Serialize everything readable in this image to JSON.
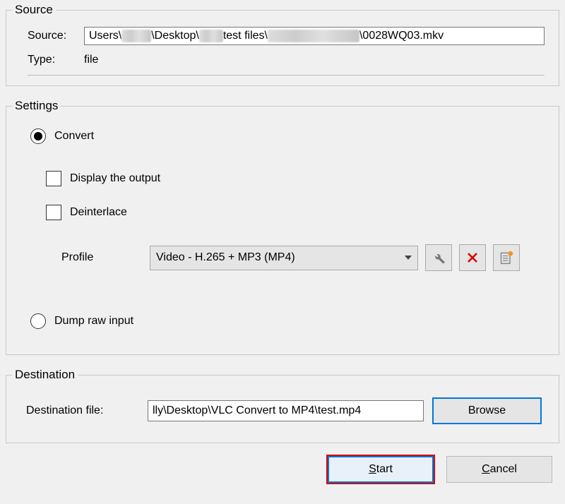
{
  "source": {
    "legend": "Source",
    "path_label": "Source:",
    "path_prefix": "Users\\",
    "path_middle1": "\\Desktop\\",
    "path_middle2": "test files\\",
    "path_filename": "\\0028WQ03.mkv",
    "type_label": "Type:",
    "type_value": "file"
  },
  "settings": {
    "legend": "Settings",
    "convert_label": "Convert",
    "convert_checked": true,
    "display_output_label": "Display the output",
    "display_output_checked": false,
    "deinterlace_label": "Deinterlace",
    "deinterlace_checked": false,
    "profile_label": "Profile",
    "profile_value": "Video - H.265 + MP3 (MP4)",
    "edit_profile_title": "Edit selected profile",
    "delete_profile_title": "Delete selected profile",
    "new_profile_title": "Create a new profile",
    "dump_label": "Dump raw input",
    "dump_checked": false
  },
  "destination": {
    "legend": "Destination",
    "file_label": "Destination file:",
    "file_value": "lly\\Desktop\\VLC Convert to MP4\\test.mp4",
    "browse_label": "Browse"
  },
  "buttons": {
    "start": "Start",
    "cancel": "Cancel"
  }
}
